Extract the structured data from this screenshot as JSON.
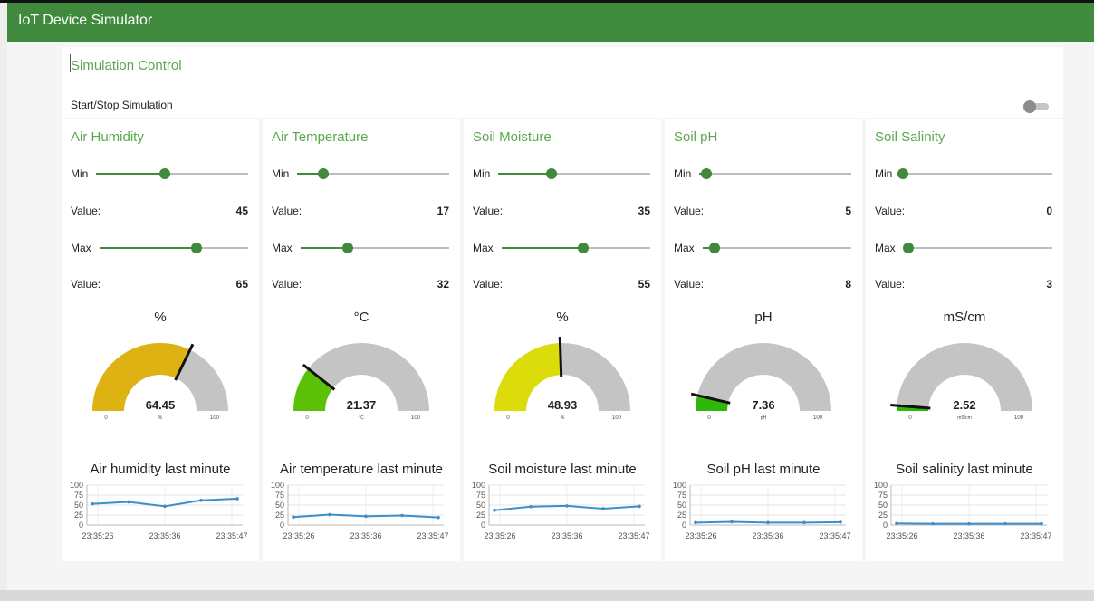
{
  "app": {
    "title": "IoT Device Simulator"
  },
  "control": {
    "title": "Simulation Control",
    "toggle_label": "Start/Stop Simulation",
    "running": false
  },
  "labels": {
    "min": "Min",
    "max": "Max",
    "value": "Value:"
  },
  "colors": {
    "brand": "#3f8a3c",
    "accent": "#5aa84e",
    "gauge_bg": "#c4c4c4",
    "line": "#3d8fcc"
  },
  "cards": [
    {
      "title": "Air Humidity",
      "min_value": "45",
      "max_value": "65",
      "unit": "%",
      "gauge": {
        "value": "64.45",
        "unit_small": "%",
        "min_label": "0",
        "max_label": "100",
        "color": "#ddb212",
        "fraction": 0.6445
      },
      "chart": {
        "title": "Air humidity last minute",
        "yticks": [
          "100",
          "75",
          "50",
          "25",
          "0"
        ],
        "xticks": [
          "23:35:26",
          "23:35:36",
          "23:35:47"
        ],
        "values": [
          53,
          58,
          47,
          62,
          66
        ]
      }
    },
    {
      "title": "Air Temperature",
      "min_value": "17",
      "max_value": "32",
      "unit": "°C",
      "gauge": {
        "value": "21.37",
        "unit_small": "°C",
        "min_label": "0",
        "max_label": "100",
        "color": "#5bc107",
        "fraction": 0.2137
      },
      "chart": {
        "title": "Air temperature last minute",
        "yticks": [
          "100",
          "75",
          "50",
          "25",
          "0"
        ],
        "xticks": [
          "23:35:26",
          "23:35:36",
          "23:35:47"
        ],
        "values": [
          20,
          26,
          22,
          24,
          19
        ]
      }
    },
    {
      "title": "Soil Moisture",
      "min_value": "35",
      "max_value": "55",
      "unit": "%",
      "gauge": {
        "value": "48.93",
        "unit_small": "%",
        "min_label": "0",
        "max_label": "100",
        "color": "#dcdc0a",
        "fraction": 0.4893
      },
      "chart": {
        "title": "Soil moisture last minute",
        "yticks": [
          "100",
          "75",
          "50",
          "25",
          "0"
        ],
        "xticks": [
          "23:35:26",
          "23:35:36",
          "23:35:47"
        ],
        "values": [
          37,
          46,
          48,
          41,
          47
        ]
      }
    },
    {
      "title": "Soil pH",
      "min_value": "5",
      "max_value": "8",
      "unit": "pH",
      "gauge": {
        "value": "7.36",
        "unit_small": "pH",
        "min_label": "0",
        "max_label": "100",
        "color": "#2db80a",
        "fraction": 0.0736
      },
      "chart": {
        "title": "Soil pH last minute",
        "yticks": [
          "100",
          "75",
          "50",
          "25",
          "0"
        ],
        "xticks": [
          "23:35:26",
          "23:35:36",
          "23:35:47"
        ],
        "values": [
          6,
          8,
          6,
          6,
          7
        ]
      }
    },
    {
      "title": "Soil Salinity",
      "min_value": "0",
      "max_value": "3",
      "unit": "mS/cm",
      "gauge": {
        "value": "2.52",
        "unit_small": "mS/cm",
        "min_label": "0",
        "max_label": "100",
        "color": "#2db80a",
        "fraction": 0.0252
      },
      "chart": {
        "title": "Soil salinity last minute",
        "yticks": [
          "100",
          "75",
          "50",
          "25",
          "0"
        ],
        "xticks": [
          "23:35:26",
          "23:35:36",
          "23:35:47"
        ],
        "values": [
          4,
          3,
          3,
          3,
          3
        ]
      }
    }
  ]
}
